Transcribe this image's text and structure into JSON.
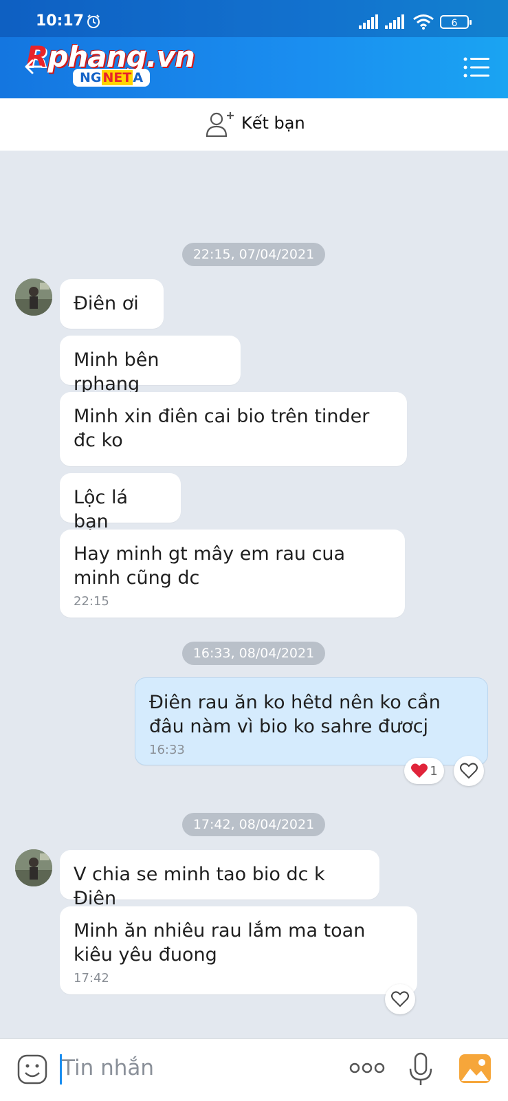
{
  "status_bar": {
    "time": "10:17",
    "battery": "6"
  },
  "header": {
    "logo_main_r": "R",
    "logo_main_rest": "phang.vn",
    "logo_sub_ng": "NG",
    "logo_sub_net": "NET",
    "logo_sub_a": "A"
  },
  "friend_bar": {
    "label": "Kết bạn"
  },
  "conversation": {
    "timestamps": [
      "22:15, 07/04/2021",
      "16:33, 08/04/2021",
      "17:42, 08/04/2021"
    ],
    "messages": [
      {
        "text": "Điên ơi"
      },
      {
        "text": "Minh bên rphang"
      },
      {
        "text": "Minh xin điên cai bio trên tinder đc ko"
      },
      {
        "text": "Lộc lá bạn"
      },
      {
        "text": "Hay minh gt mây em rau cua minh cũng dc",
        "time": "22:15"
      },
      {
        "text": "Điên rau ăn ko hêtd nên ko cần đâu nàm vì bio ko sahre đươcj",
        "time": "16:33",
        "reaction_count": "1"
      },
      {
        "text": "V chia se minh tao bio dc k Điên"
      },
      {
        "text": "Minh ăn nhiêu rau lắm ma toan kiêu yêu đuong",
        "time": "17:42"
      }
    ]
  },
  "input": {
    "placeholder": "Tin nhắn"
  },
  "icons": [
    "back-icon",
    "menu-icon",
    "add-friend-icon",
    "emoji-icon",
    "more-icon",
    "mic-icon",
    "gallery-icon",
    "heart-icon"
  ],
  "colors": {
    "header": "#1a8ef0",
    "own_bubble": "#d5ebfd",
    "background": "#e3e8ef",
    "heart": "#e0243a"
  }
}
